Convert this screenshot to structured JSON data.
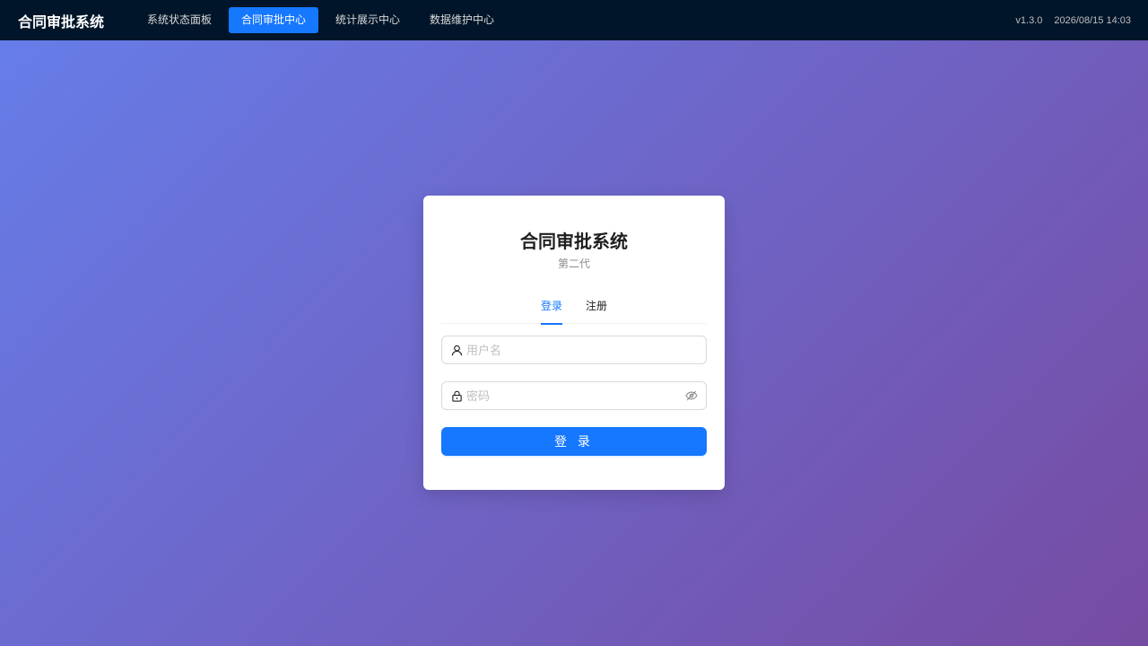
{
  "header": {
    "brand": "合同审批系统",
    "nav": [
      {
        "label": "系统状态面板",
        "active": false
      },
      {
        "label": "合同审批中心",
        "active": true
      },
      {
        "label": "统计展示中心",
        "active": false
      },
      {
        "label": "数据维护中心",
        "active": false
      }
    ],
    "version": "v1.3.0",
    "datetime": "2026/08/15 14:03"
  },
  "login_card": {
    "title": "合同审批系统",
    "subtitle": "第二代",
    "tabs": [
      {
        "label": "登录",
        "active": true
      },
      {
        "label": "注册",
        "active": false
      }
    ],
    "username": {
      "value": "",
      "placeholder": "用户名",
      "icon": "user-icon"
    },
    "password": {
      "value": "",
      "placeholder": "密码",
      "icon": "lock-icon",
      "toggle_icon": "eye-invisible-icon"
    },
    "submit_label": "登 录"
  },
  "colors": {
    "topbar_bg": "#001529",
    "accent": "#1677ff",
    "gradient_start": "#667eea",
    "gradient_end": "#764ba2"
  }
}
